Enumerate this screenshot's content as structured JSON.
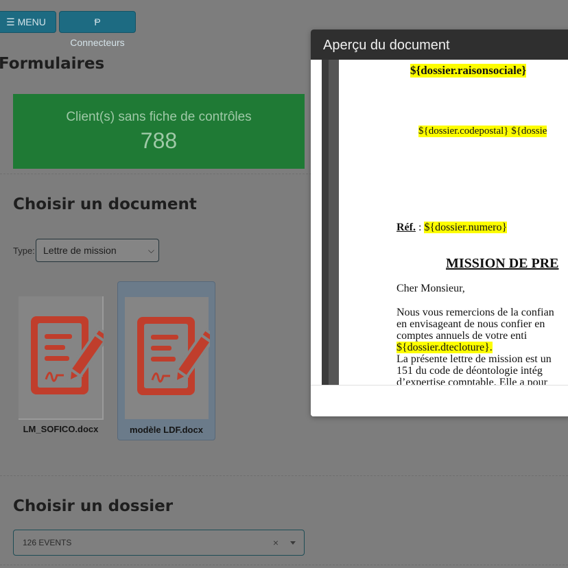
{
  "toolbar": {
    "menu_label": "☰ MENU",
    "connectors_label": "Ᵽ Connecteurs"
  },
  "page": {
    "title": "Formulaires"
  },
  "stat": {
    "label": "Client(s) sans fiche de contrôles",
    "value": "788",
    "color": "#1f7a35"
  },
  "documents": {
    "heading": "Choisir un document",
    "type_label": "Type:",
    "type_value": "Lettre de mission",
    "items": [
      {
        "name": "LM_SOFICO.docx",
        "selected": false,
        "icon": "signed-document-icon"
      },
      {
        "name": "modèle LDF.docx",
        "selected": true,
        "icon": "signed-document-icon"
      }
    ]
  },
  "dossier": {
    "heading": "Choisir un dossier",
    "value": "126 EVENTS",
    "clear": "×"
  },
  "modal": {
    "title": "Aperçu du document",
    "page": {
      "raison_sociale": "${dossier.raisonsociale}",
      "codepostal": "${dossier.codepostal} ${dossie",
      "ref_label": "Réf.",
      "ref_sep": " : ",
      "ref_value": "${dossier.numero}",
      "mission_heading": "MISSION DE PRE",
      "greeting": "Cher Monsieur,",
      "body": {
        "l1": "Nous vous remercions de la confian",
        "l2": "en envisageant de nous confier en",
        "l3": "comptes annuels de votre enti",
        "l4_highlight": "${dossier.dtecloture}.",
        "l5": "La présente lettre de mission est un",
        "l6": "151 du code de déontologie intég",
        "l7": "d’expertise comptable. Elle a pour"
      }
    }
  }
}
